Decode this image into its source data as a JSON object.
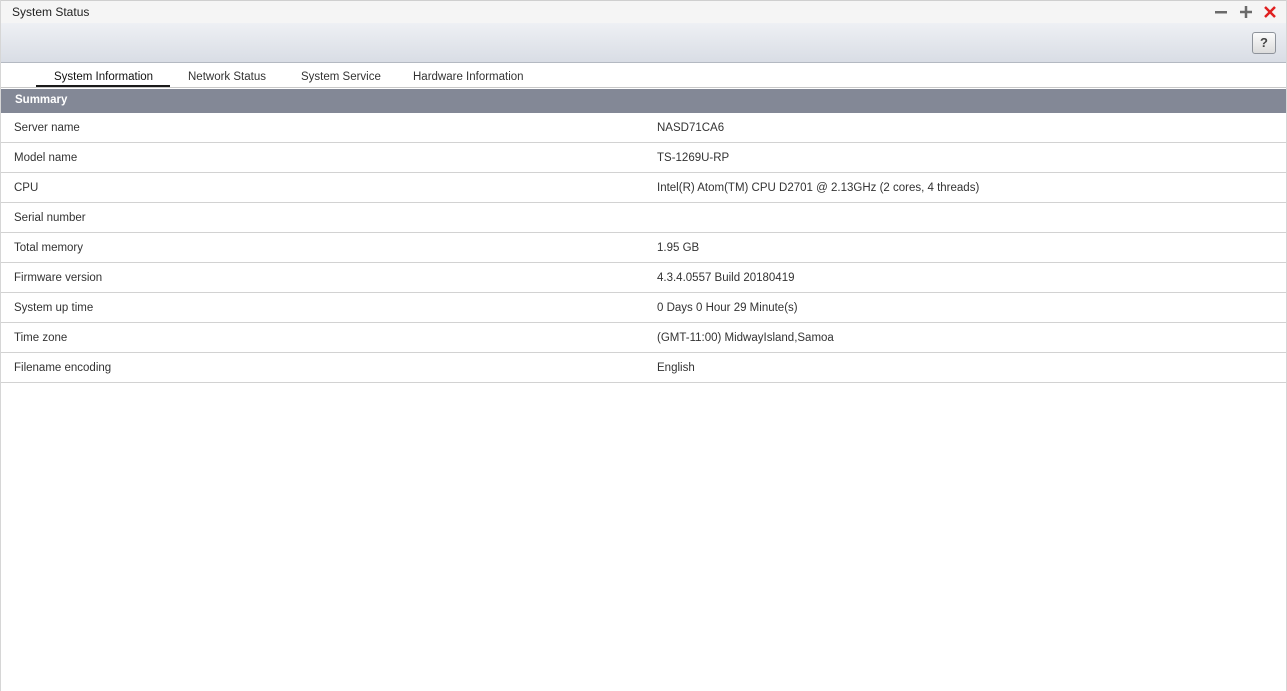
{
  "window": {
    "title": "System Status",
    "controls": {
      "minimize": "minus-icon",
      "maximize": "plus-icon",
      "close": "close-icon",
      "close_color": "#e02020"
    }
  },
  "toolbar": {
    "help_label": "?"
  },
  "tabs": [
    {
      "label": "System Information",
      "active": true
    },
    {
      "label": "Network Status",
      "active": false
    },
    {
      "label": "System Service",
      "active": false
    },
    {
      "label": "Hardware Information",
      "active": false
    }
  ],
  "summary": {
    "header": "Summary",
    "rows": [
      {
        "label": "Server name",
        "value": "NASD71CA6"
      },
      {
        "label": "Model name",
        "value": "TS-1269U-RP"
      },
      {
        "label": "CPU",
        "value": "Intel(R) Atom(TM) CPU D2701 @ 2.13GHz (2 cores, 4 threads)"
      },
      {
        "label": "Serial number",
        "value": ""
      },
      {
        "label": "Total memory",
        "value": "1.95 GB"
      },
      {
        "label": "Firmware version",
        "value": "4.3.4.0557 Build 20180419"
      },
      {
        "label": "System up time",
        "value": "0 Days 0 Hour 29 Minute(s)"
      },
      {
        "label": "Time zone",
        "value": "(GMT-11:00) MidwayIsland,Samoa"
      },
      {
        "label": "Filename encoding",
        "value": "English"
      }
    ]
  },
  "colors": {
    "summary_header_bg": "#838896",
    "toolbar_gradient_top": "#eef0f4",
    "toolbar_gradient_bottom": "#d9dde5"
  }
}
